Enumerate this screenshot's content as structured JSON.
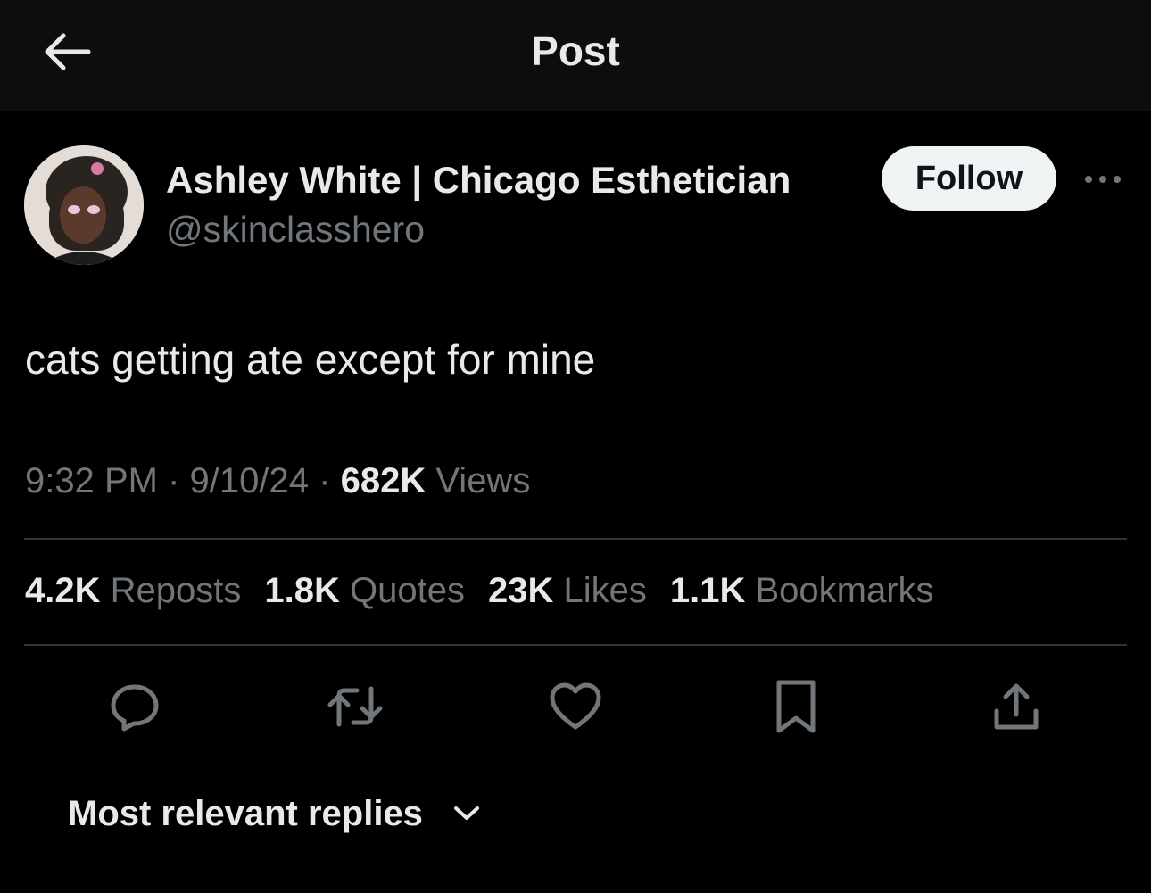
{
  "header": {
    "title": "Post",
    "back_icon": "arrow-left-icon"
  },
  "author": {
    "display_name": "Ashley White | Chicago Esthetician",
    "handle": "@skinclasshero",
    "follow_label": "Follow",
    "more_icon": "more-horizontal-icon"
  },
  "post": {
    "text": "cats getting ate except for mine",
    "time": "9:32 PM",
    "date": "9/10/24",
    "views_count": "682K",
    "views_label": "Views",
    "separator": "·"
  },
  "stats": {
    "reposts_count": "4.2K",
    "reposts_label": "Reposts",
    "quotes_count": "1.8K",
    "quotes_label": "Quotes",
    "likes_count": "23K",
    "likes_label": "Likes",
    "bookmarks_count": "1.1K",
    "bookmarks_label": "Bookmarks"
  },
  "actions": [
    "reply-icon",
    "repost-icon",
    "like-icon",
    "bookmark-icon",
    "share-icon"
  ],
  "replies": {
    "sort_label": "Most relevant replies",
    "chevron_icon": "chevron-down-icon"
  },
  "colors": {
    "background": "#000000",
    "header_background": "#0d0d0d",
    "text_primary": "#e7e9ea",
    "text_secondary": "#71767b",
    "divider": "#2f3336",
    "follow_button_bg": "#eff3f4",
    "follow_button_text": "#0f1419"
  }
}
